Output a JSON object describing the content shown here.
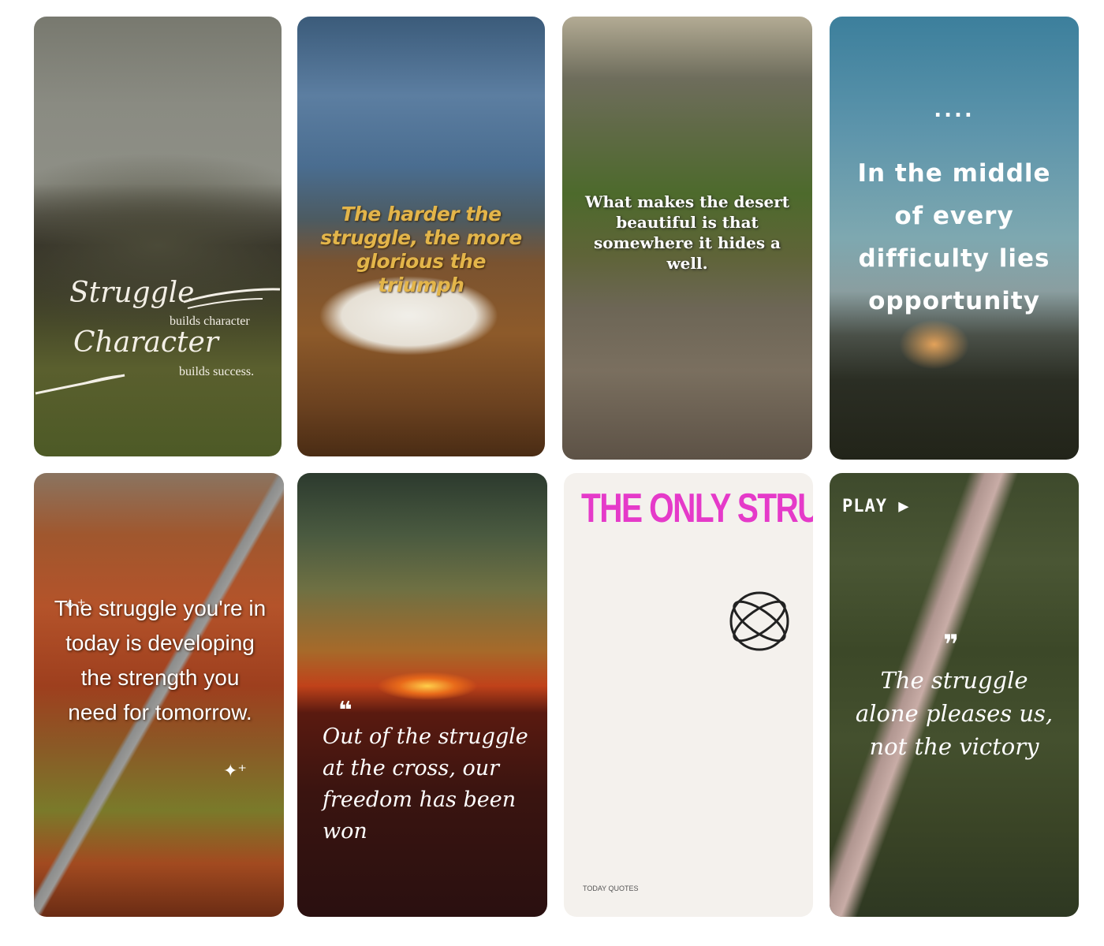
{
  "cards": [
    {
      "parts": [
        "Struggle",
        "builds character",
        "Character",
        "builds success."
      ]
    },
    {
      "quote": "The harder the struggle, the more glorious the triumph"
    },
    {
      "quote": "What makes the desert beautiful is that somewhere it hides a well."
    },
    {
      "dots": "....",
      "quote": "In the middle of every difficulty lies opportunity"
    },
    {
      "sparkle": "✦⁺",
      "quote": "The struggle you're in today is developing the strength you need for tomorrow."
    },
    {
      "mark": "❝",
      "quote": "Out of the struggle at the cross, our freedom has been won"
    },
    {
      "quote": "THE ONLY STRUGGLE YOU'RE GOING TO HAVE IS THE STRUGGLE WITH YOURSELF.",
      "brand": "TODAY QUOTES"
    },
    {
      "play": "PLAY ▶",
      "mark": "❞",
      "quote": "The struggle alone pleases us, not the victory"
    }
  ],
  "colors": {
    "pink_text": "#e53ac9",
    "gold_text": "#e3b54a"
  }
}
